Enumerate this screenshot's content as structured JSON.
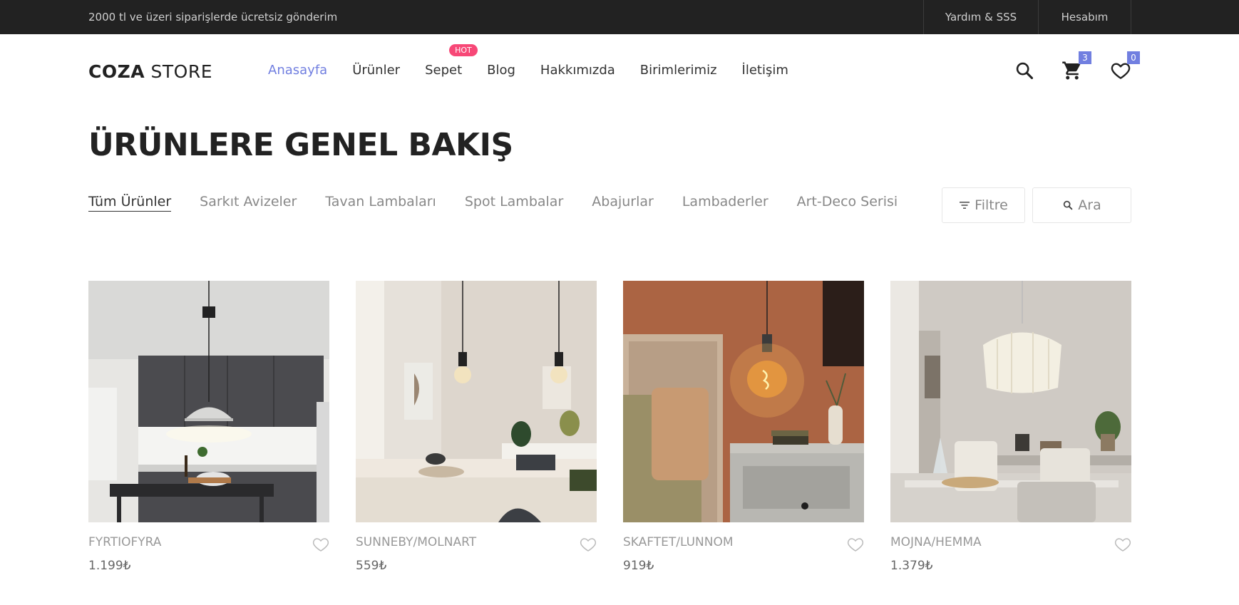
{
  "topbar": {
    "promo": "2000 tl ve üzeri siparişlerde ücretsiz gönderim",
    "help": "Yardım & SSS",
    "account": "Hesabım"
  },
  "header": {
    "logo_bold": "COZA",
    "logo_light": "STORE",
    "nav": [
      {
        "label": "Anasayfa",
        "active": true
      },
      {
        "label": "Ürünler"
      },
      {
        "label": "Sepet",
        "badge": "HOT"
      },
      {
        "label": "Blog"
      },
      {
        "label": "Hakkımızda"
      },
      {
        "label": "Birimlerimiz"
      },
      {
        "label": "İletişim"
      }
    ],
    "cart_count": "3",
    "wishlist_count": "0"
  },
  "page_title": "ÜRÜNLERE GENEL BAKIŞ",
  "filters": [
    {
      "label": "Tüm Ürünler",
      "active": true
    },
    {
      "label": "Sarkıt Avizeler"
    },
    {
      "label": "Tavan Lambaları"
    },
    {
      "label": "Spot Lambalar"
    },
    {
      "label": "Abajurlar"
    },
    {
      "label": "Lambaderler"
    },
    {
      "label": "Art-Deco Serisi"
    }
  ],
  "actions": {
    "filter_label": "Filtre",
    "search_label": "Ara"
  },
  "products": [
    {
      "name": "FYRTIOFYRA",
      "price": "1.199₺"
    },
    {
      "name": "SUNNEBY/MOLNART",
      "price": "559₺"
    },
    {
      "name": "SKAFTET/LUNNOM",
      "price": "919₺"
    },
    {
      "name": "MOJNA/HEMMA",
      "price": "1.379₺"
    }
  ],
  "colors": {
    "accent": "#717fe0",
    "hot": "#f74877",
    "topbar": "#222222"
  }
}
